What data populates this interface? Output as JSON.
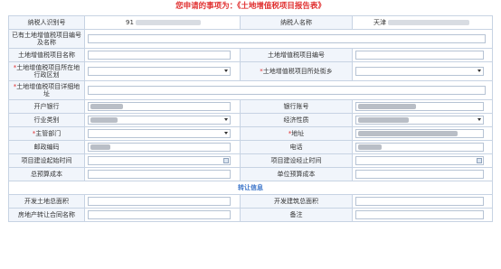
{
  "title": "您申请的事项为：《土地增值税项目报告表》",
  "labels": {
    "taxpayer_id": "纳税人识别号",
    "taxpayer_name": "纳税人名称",
    "existing_project": "已有土地增值税项目编号及名称",
    "project_name": "土地增值税项目名称",
    "project_no": "土地增值税项目编号",
    "project_district": "土地增值税项目所在地行政区划",
    "project_street": "土地增值税项目所处街乡",
    "project_address": "土地增值税项目详细地址",
    "bank": "开户银行",
    "bank_account": "银行账号",
    "industry": "行业类别",
    "economic_nature": "经济性质",
    "authority": "主管部门",
    "address": "地址",
    "postcode": "邮政编码",
    "phone": "电话",
    "start_date": "项目建设起始时间",
    "end_date": "项目建设经止时间",
    "total_budget": "总预算成本",
    "unit_budget": "单位预算成本",
    "transfer_section": "转让信息",
    "land_area": "开发土地总面积",
    "building_area": "开发建筑总面积",
    "contract_name": "房地产转让合同名称",
    "remarks": "备注"
  },
  "values": {
    "taxpayer_id_prefix": "91",
    "taxpayer_name_prefix": "天津"
  }
}
